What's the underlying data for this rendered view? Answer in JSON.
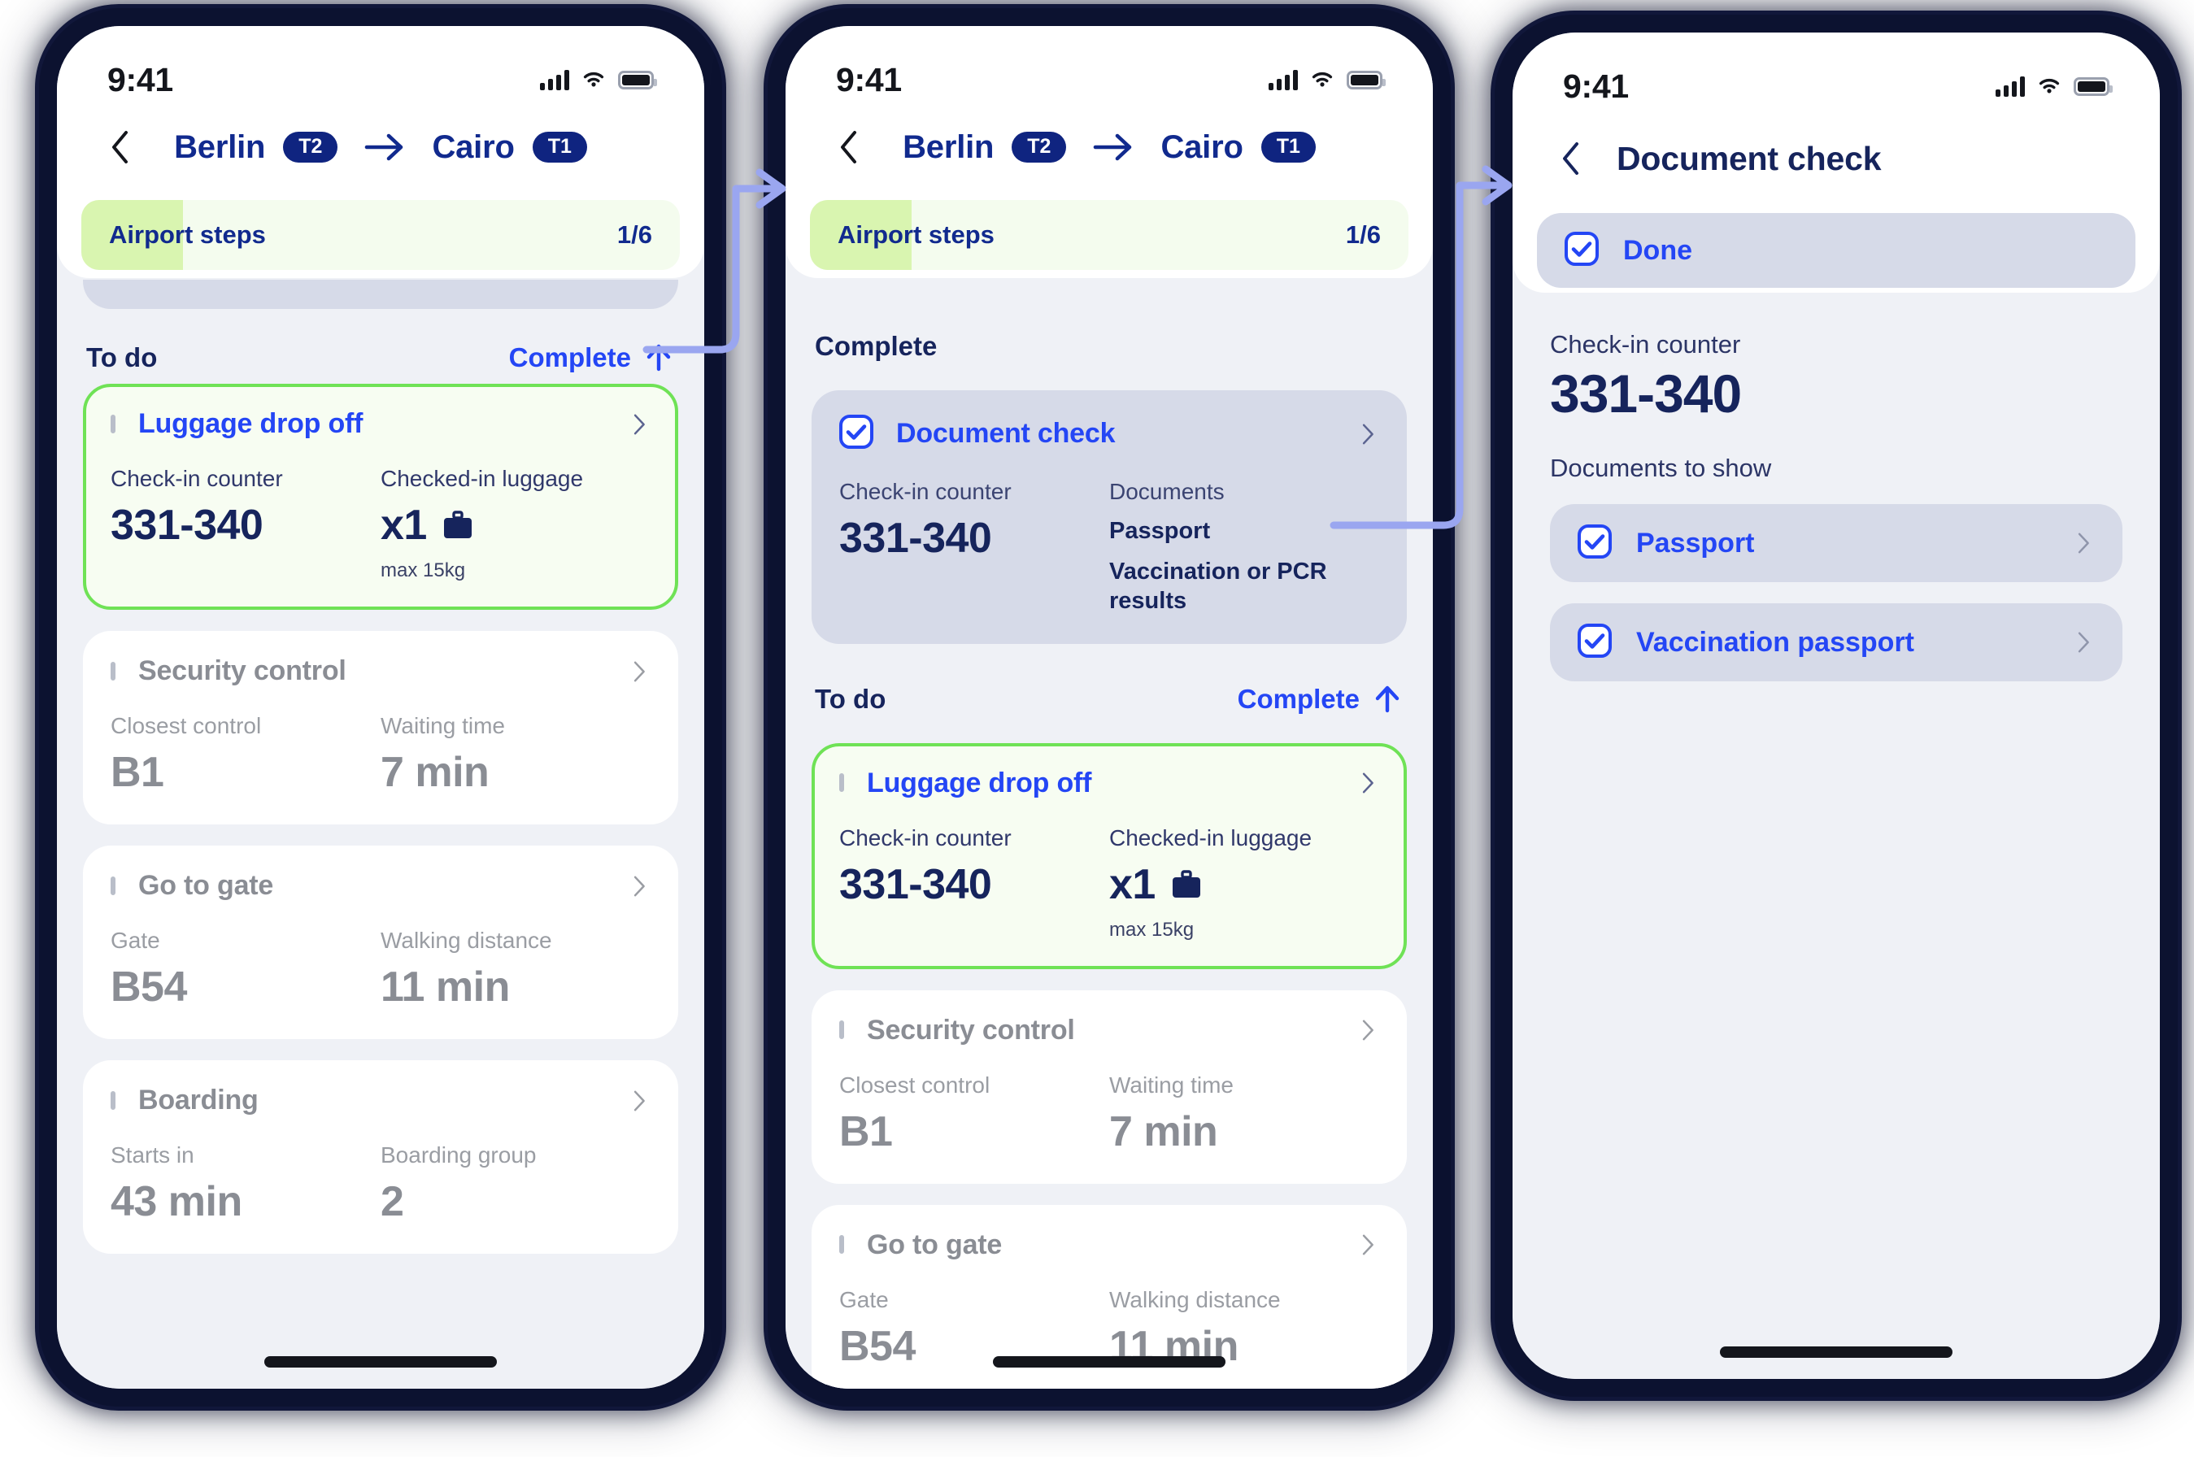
{
  "status_bar": {
    "time": "9:41",
    "icons": [
      "signal-bars-icon",
      "wifi-icon",
      "battery-icon"
    ]
  },
  "colors": {
    "accent_blue": "#2446f5",
    "navy": "#16245c",
    "route_blue": "#112a8e",
    "green_border": "#6fe256",
    "green_fill": "#f7fdf2",
    "progress_fill": "#d9f5b0",
    "progress_track": "#f4fcee",
    "page_bg": "#eff1f6",
    "done_card_bg": "#d6dae8",
    "idle_text": "#8a8d94",
    "connector": "#9aa6f0"
  },
  "screen1": {
    "nav": {
      "back_icon": "chevron-left-icon",
      "origin": "Berlin",
      "origin_terminal": "T2",
      "route_icon": "arrow-right-icon",
      "destination": "Cairo",
      "destination_terminal": "T1"
    },
    "progress": {
      "label": "Airport steps",
      "count": "1/6",
      "percent": 17
    },
    "section": {
      "title": "To do",
      "action": "Complete",
      "action_icon": "arrow-up-icon"
    },
    "cards": [
      {
        "title": "Luggage drop off",
        "state": "active",
        "checked": false,
        "chevron": "chevron-right-icon",
        "col1": {
          "label": "Check-in counter",
          "value": "331-340"
        },
        "col2": {
          "label": "Checked-in luggage",
          "value": "x1",
          "icon": "briefcase-icon",
          "sub": "max 15kg"
        }
      },
      {
        "title": "Security control",
        "state": "idle",
        "checked": false,
        "chevron": "chevron-right-icon",
        "col1": {
          "label": "Closest control",
          "value": "B1"
        },
        "col2": {
          "label": "Waiting time",
          "value": "7 min"
        }
      },
      {
        "title": "Go to gate",
        "state": "idle",
        "checked": false,
        "chevron": "chevron-right-icon",
        "col1": {
          "label": "Gate",
          "value": "B54"
        },
        "col2": {
          "label": "Walking distance",
          "value": "11 min"
        }
      },
      {
        "title": "Boarding",
        "state": "idle",
        "checked": false,
        "chevron": "chevron-right-icon",
        "col1": {
          "label": "Starts in",
          "value": "43 min"
        },
        "col2": {
          "label": "Boarding group",
          "value": "2"
        }
      }
    ]
  },
  "screen2": {
    "nav": {
      "back_icon": "chevron-left-icon",
      "origin": "Berlin",
      "origin_terminal": "T2",
      "route_icon": "arrow-right-icon",
      "destination": "Cairo",
      "destination_terminal": "T1"
    },
    "progress": {
      "label": "Airport steps",
      "count": "1/6",
      "percent": 17
    },
    "complete_section": {
      "title": "Complete"
    },
    "complete_card": {
      "title": "Document check",
      "state": "done",
      "checked": true,
      "chevron": "chevron-right-icon",
      "col1": {
        "label": "Check-in counter",
        "value": "331-340"
      },
      "col2": {
        "label": "Documents",
        "items": [
          "Passport",
          "Vaccination or PCR results"
        ]
      }
    },
    "todo_section": {
      "title": "To do",
      "action": "Complete",
      "action_icon": "arrow-up-icon"
    },
    "cards": [
      {
        "title": "Luggage drop off",
        "state": "active",
        "checked": false,
        "chevron": "chevron-right-icon",
        "col1": {
          "label": "Check-in counter",
          "value": "331-340"
        },
        "col2": {
          "label": "Checked-in luggage",
          "value": "x1",
          "icon": "briefcase-icon",
          "sub": "max 15kg"
        }
      },
      {
        "title": "Security control",
        "state": "idle",
        "checked": false,
        "chevron": "chevron-right-icon",
        "col1": {
          "label": "Closest control",
          "value": "B1"
        },
        "col2": {
          "label": "Waiting time",
          "value": "7 min"
        }
      },
      {
        "title": "Go to gate",
        "state": "idle",
        "checked": false,
        "chevron": "chevron-right-icon",
        "col1": {
          "label": "Gate",
          "value": "B54"
        },
        "col2": {
          "label": "Walking distance",
          "value": "11 min"
        }
      }
    ]
  },
  "screen3": {
    "nav": {
      "back_icon": "chevron-left-icon",
      "title": "Document check"
    },
    "done_row": {
      "label": "Done",
      "checked": true
    },
    "counter": {
      "label": "Check-in counter",
      "value": "331-340"
    },
    "documents": {
      "label": "Documents to show",
      "items": [
        {
          "label": "Passport",
          "checked": true,
          "chevron": "chevron-right-icon"
        },
        {
          "label": "Vaccination passport",
          "checked": true,
          "chevron": "chevron-right-icon"
        }
      ]
    }
  }
}
